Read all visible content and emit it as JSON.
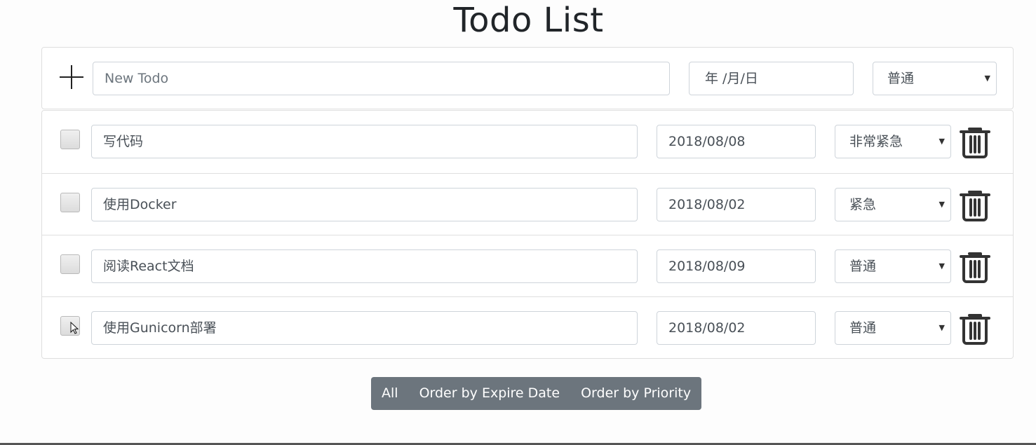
{
  "app": {
    "title": "Todo List"
  },
  "new_todo": {
    "add_icon": "plus-icon",
    "placeholder": "New Todo",
    "date_placeholder": "年 /月/日",
    "priority": "普通"
  },
  "todos": [
    {
      "text": "写代码",
      "date": "2018/08/08",
      "priority": "非常紧急",
      "done": false
    },
    {
      "text": "使用Docker",
      "date": "2018/08/02",
      "priority": "紧急",
      "done": false
    },
    {
      "text": "阅读React文档",
      "date": "2018/08/09",
      "priority": "普通",
      "done": false
    },
    {
      "text": "使用Gunicorn部署",
      "date": "2018/08/02",
      "priority": "普通",
      "done": false
    }
  ],
  "icons": {
    "delete": "trash-icon",
    "dropdown": "caret-down-icon"
  },
  "filters": {
    "all": "All",
    "by_date": "Order by Expire Date",
    "by_priority": "Order by Priority"
  },
  "colors": {
    "button_group_bg": "#6c757d",
    "border": "#dfdfdf"
  }
}
